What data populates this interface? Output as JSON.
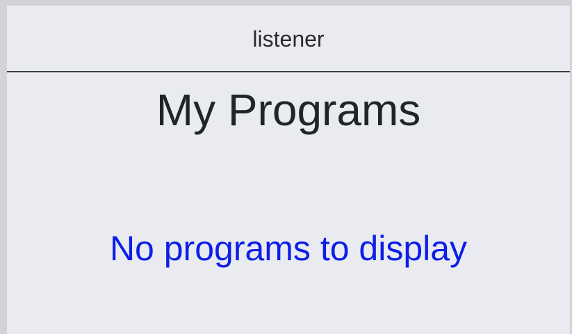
{
  "header": {
    "title": "listener"
  },
  "main": {
    "title": "My Programs",
    "empty_message": "No programs to display"
  },
  "colors": {
    "background": "#e9ebf0",
    "header_text": "#2a2b2e",
    "title_text": "#212529",
    "empty_message": "#0d1ee8",
    "divider": "#3d3e40"
  }
}
